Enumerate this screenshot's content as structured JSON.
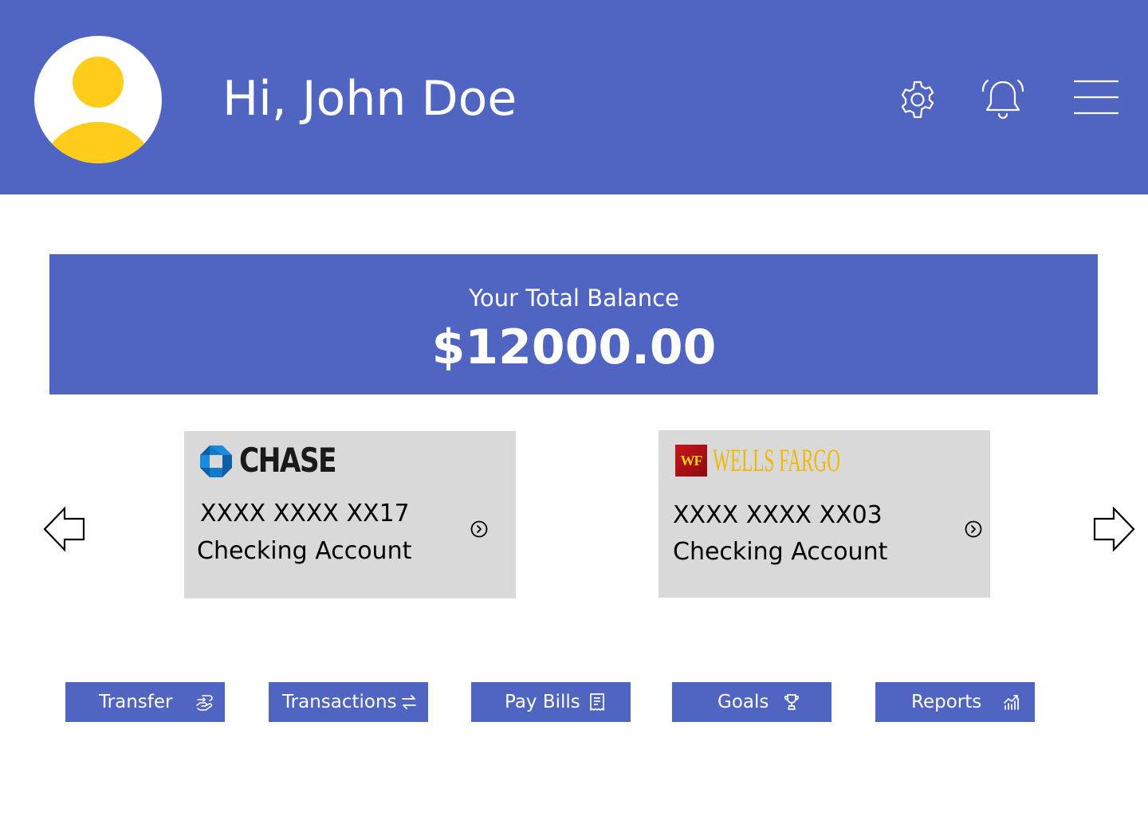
{
  "header": {
    "greeting": "Hi, John Doe",
    "icons": [
      "settings-icon",
      "bell-icon",
      "hamburger-menu-icon"
    ]
  },
  "balance": {
    "label": "Your Total Balance",
    "amount": "$12000.00"
  },
  "accounts": [
    {
      "bank": "CHASE",
      "number": "XXXX XXXX XX17",
      "type": "Checking Account"
    },
    {
      "bank_badge": "WF",
      "bank": "WELLS FARGO",
      "number": "XXXX XXXX XX03",
      "type": "Checking Account"
    }
  ],
  "actions": [
    {
      "label": "Transfer",
      "icon": "hand-transfer-icon"
    },
    {
      "label": "Transactions",
      "icon": "swap-arrows-icon"
    },
    {
      "label": "Pay Bills",
      "icon": "receipt-icon"
    },
    {
      "label": "Goals",
      "icon": "trophy-icon"
    },
    {
      "label": "Reports",
      "icon": "chart-growth-icon"
    }
  ],
  "colors": {
    "primary": "#5064C2",
    "card_bg": "#D9D9D9",
    "avatar_accent": "#FFCC1A",
    "chase_blue": "#117ACA",
    "wf_red": "#C8141B",
    "wf_gold": "#F2B705"
  }
}
